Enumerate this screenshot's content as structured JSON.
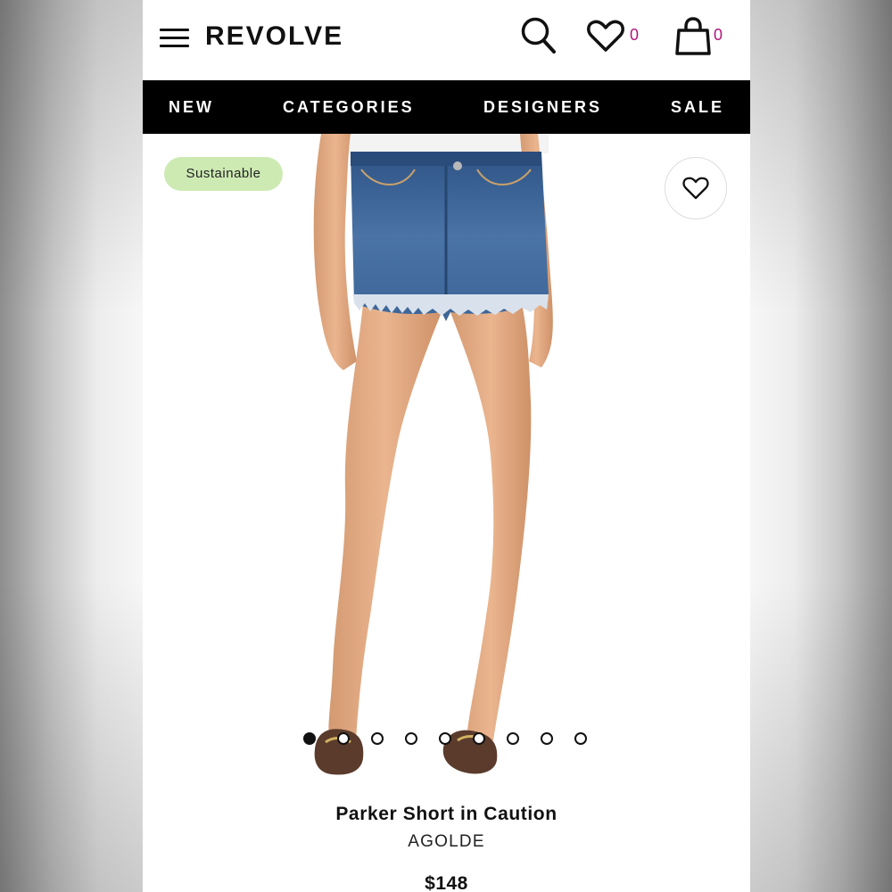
{
  "header": {
    "logo": "REVOLVE",
    "wishlist_count": "0",
    "bag_count": "0"
  },
  "nav": {
    "items": [
      {
        "label": "NEW"
      },
      {
        "label": "CATEGORIES"
      },
      {
        "label": "DESIGNERS"
      },
      {
        "label": "SALE"
      }
    ]
  },
  "product": {
    "badge": "Sustainable",
    "image_count": 9,
    "active_image": 1,
    "name": "Parker Short in Caution",
    "brand": "AGOLDE",
    "price": "$148"
  },
  "colors": {
    "badge_bg": "#cdeab3",
    "count_accent": "#b0157a",
    "nav_bg": "#000000",
    "denim": "#3a5f8f"
  },
  "icons": [
    "menu-icon",
    "search-icon",
    "heart-icon",
    "shopping-bag-icon"
  ]
}
